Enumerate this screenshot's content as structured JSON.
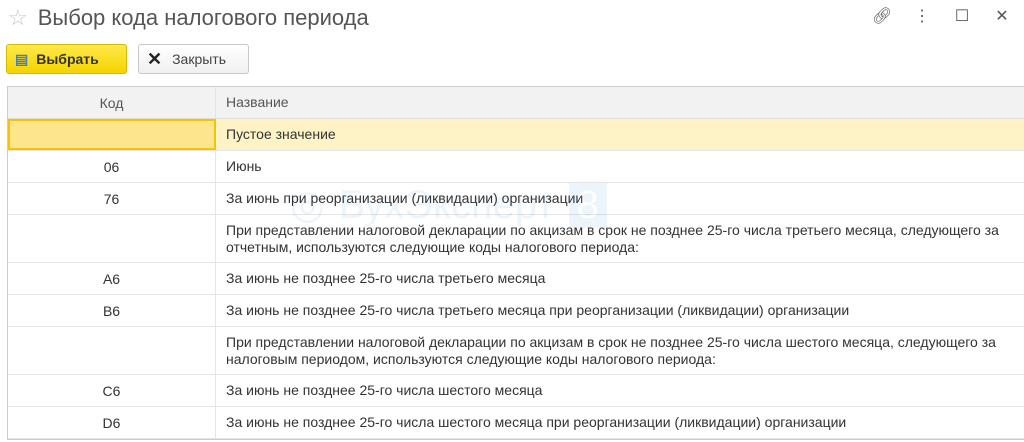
{
  "window": {
    "title": "Выбор кода налогового периода"
  },
  "toolbar": {
    "select_label": "Выбрать",
    "close_label": "Закрыть"
  },
  "table": {
    "headers": [
      "Код",
      "Название"
    ],
    "rows": [
      {
        "code": "",
        "name": "Пустое значение"
      },
      {
        "code": "06",
        "name": "Июнь"
      },
      {
        "code": "76",
        "name": "За июнь при реорганизации (ликвидации) организации"
      },
      {
        "code": "",
        "name": "При представлении налоговой декларации по акцизам в срок не позднее 25-го числа третьего месяца, следующего за отчетным, используются следующие коды налогового периода:"
      },
      {
        "code": "А6",
        "name": "За июнь не позднее 25-го числа третьего месяца"
      },
      {
        "code": "В6",
        "name": "За июнь не позднее 25-го числа третьего месяца при реорганизации (ликвидации) организации"
      },
      {
        "code": "",
        "name": "При представлении налоговой декларации по акцизам в срок не позднее 25-го числа шестого месяца, следующего за налоговым периодом, используются следующие коды налогового периода:"
      },
      {
        "code": "С6",
        "name": "За июнь не позднее 25-го числа шестого месяца"
      },
      {
        "code": "D6",
        "name": "За июнь не позднее 25-го числа шестого месяца при реорганизации (ликвидации) организации"
      }
    ]
  },
  "watermark": {
    "text": "БухЭксперт",
    "badge": "8"
  }
}
